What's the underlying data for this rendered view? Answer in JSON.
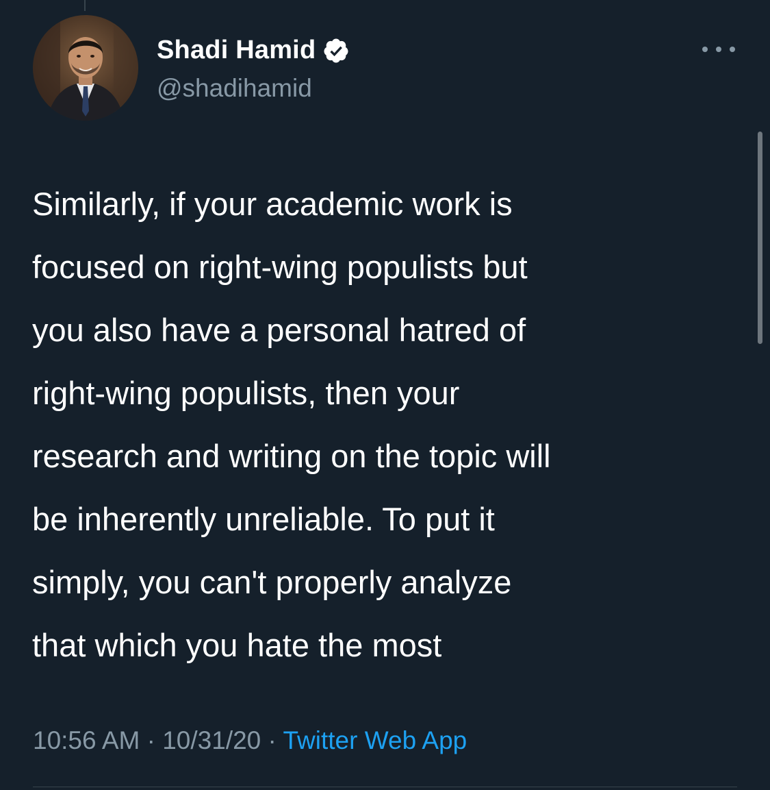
{
  "tweet": {
    "author": {
      "display_name": "Shadi Hamid",
      "handle": "@shadihamid",
      "verified": true
    },
    "text_lines": [
      "Similarly, if your academic work is",
      "focused on right-wing populists but",
      "you also have a personal hatred of",
      "right-wing populists, then your",
      "research and writing on the topic will",
      "be inherently unreliable. To put it",
      "simply, you can't properly analyze",
      "that which you hate the most"
    ],
    "time": "10:56 AM",
    "separator": "·",
    "date": "10/31/20",
    "source": "Twitter Web App"
  },
  "colors": {
    "background": "#15202b",
    "primary_text": "#ffffff",
    "secondary_text": "#8899a6",
    "accent": "#1da1f2"
  },
  "icons": {
    "verified": "verified-badge-icon",
    "more": "more-options-icon"
  }
}
